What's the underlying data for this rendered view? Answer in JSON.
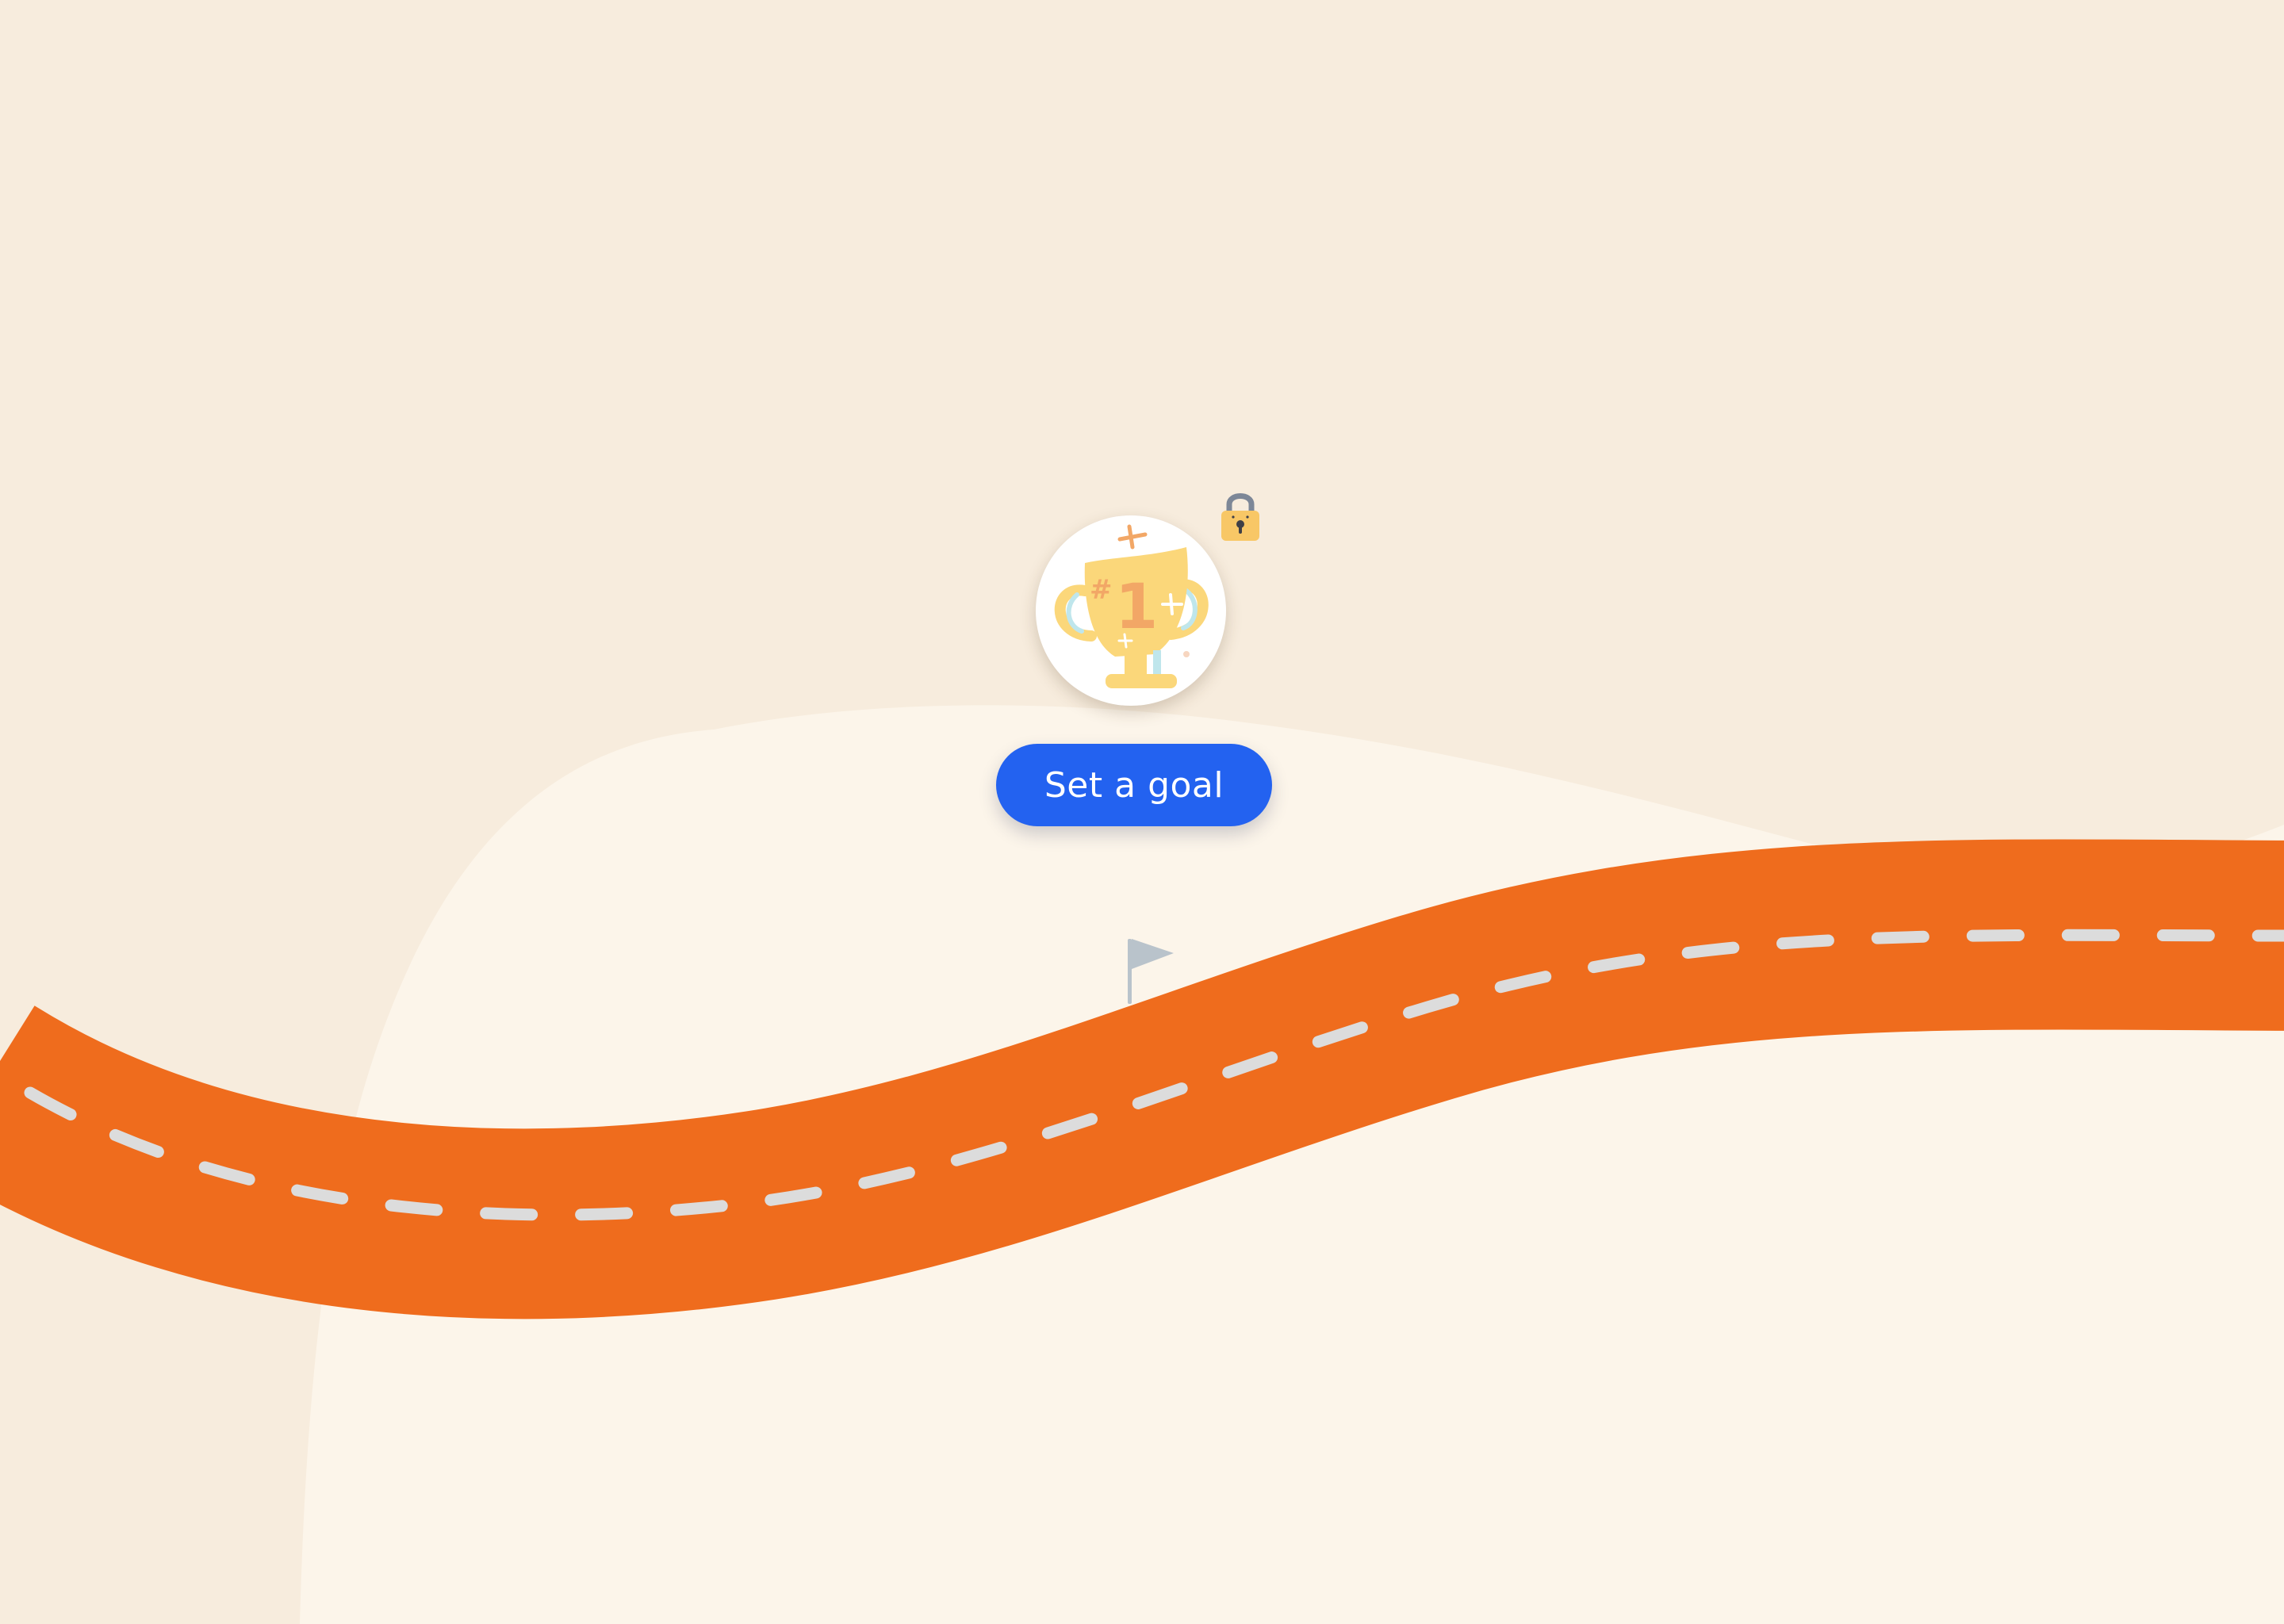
{
  "goal_button": {
    "label": "Set a goal"
  },
  "trophy": {
    "icon": "trophy-icon",
    "rank_text": "#1",
    "status_icon": "lock-icon"
  },
  "road": {
    "marker_icon": "flag-icon"
  },
  "colors": {
    "background": "#f7ecdd",
    "hill": "#fcf5ea",
    "road": "#ef6c1d",
    "road_dash": "#dcdcdc",
    "button": "#2362f0",
    "button_text": "#ffffff",
    "trophy_gold": "#fbd77a",
    "trophy_number": "#f2a766",
    "lock_body": "#f8c766",
    "lock_shackle": "#7d8797",
    "flag": "#b9c3cb"
  }
}
